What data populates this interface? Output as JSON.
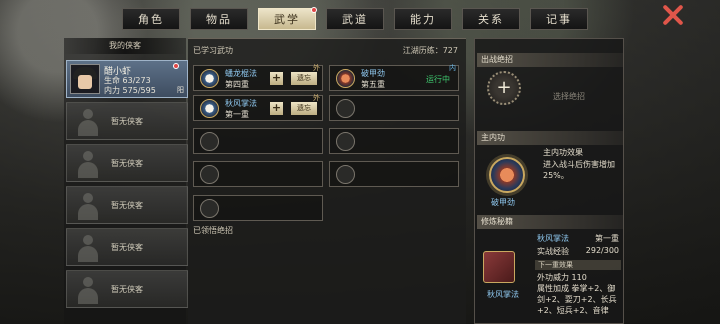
{
  "tabs": [
    {
      "label": "角色"
    },
    {
      "label": "物品"
    },
    {
      "label": "武学"
    },
    {
      "label": "武道"
    },
    {
      "label": "能力"
    },
    {
      "label": "关系"
    },
    {
      "label": "记事"
    }
  ],
  "active_tab": "武学",
  "left": {
    "header": "我的侠客",
    "hero": {
      "name": "醋小虾",
      "hp_label": "生命",
      "hp": "63/273",
      "mp_label": "内力",
      "mp": "575/595",
      "tag": "阳"
    },
    "empty_label": "暂无侠客"
  },
  "middle": {
    "title": "已学习武功",
    "exp_label": "江湖历练：727",
    "skills": [
      {
        "name": "蟠龙棍法",
        "level": "第四重",
        "plus": "+",
        "equip": "遗忘",
        "corner": "外"
      },
      {
        "name": "破甲劲",
        "level": "第五重",
        "status": "运行中",
        "corner": "内"
      },
      {
        "name": "秋风掌法",
        "level": "第一重",
        "plus": "+",
        "equip": "遗忘",
        "corner": "外"
      }
    ],
    "sub_title": "已领悟绝招"
  },
  "right": {
    "ult_section": "出战绝招",
    "ult_plus": "+",
    "ult_label": "选择绝招",
    "inner_section": "主内功",
    "inner_effect_title": "主内功效果",
    "inner_effect_desc": "进入战斗后伤害增加25%。",
    "inner_name": "破甲劲",
    "manual_section": "修炼秘籍",
    "manual_name": "秋风掌法",
    "manual_level": "第一重",
    "exp_label": "实战经验",
    "exp_value": "292/300",
    "next_label": "下一重效果",
    "next_power": "外功威力 110",
    "attr_text": "属性加成  拳掌+2、御剑+2、耍刀+2、长兵+2、短兵+2、音律",
    "book_label": "秋风掌法"
  }
}
